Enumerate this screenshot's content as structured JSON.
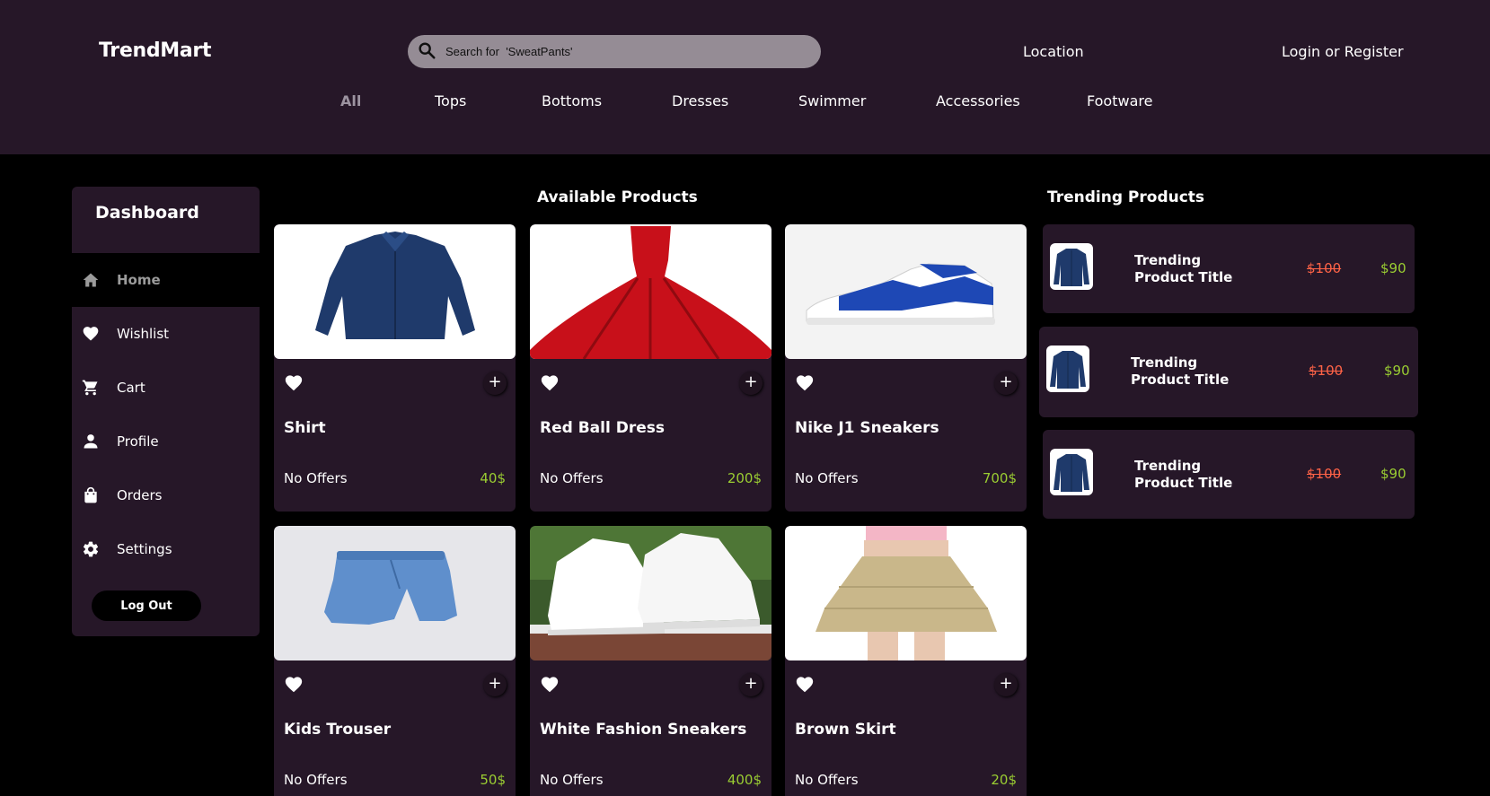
{
  "header": {
    "brand": "TrendMart",
    "search_placeholder": "Search for  'SweatPants'",
    "location_label": "Location",
    "login_label": "Login or Register"
  },
  "nav": {
    "items": [
      "All",
      "Tops",
      "Bottoms",
      "Dresses",
      "Swimmer",
      "Accessories",
      "Footware"
    ],
    "active": "All"
  },
  "sidebar": {
    "title": "Dashboard",
    "items": [
      {
        "label": "Home",
        "icon": "home-icon",
        "active": true
      },
      {
        "label": "Wishlist",
        "icon": "heart-icon",
        "active": false
      },
      {
        "label": "Cart",
        "icon": "cart-icon",
        "active": false
      },
      {
        "label": "Profile",
        "icon": "person-icon",
        "active": false
      },
      {
        "label": "Orders",
        "icon": "shopping-bag-icon",
        "active": false
      },
      {
        "label": "Settings",
        "icon": "gear-icon",
        "active": false
      }
    ],
    "logout_label": "Log Out"
  },
  "products": {
    "title": "Available Products",
    "add_label": "+",
    "items": [
      {
        "name": "Shirt",
        "offer": "No Offers",
        "price": "40$",
        "image": "navy-shirt"
      },
      {
        "name": "Red Ball Dress",
        "offer": "No Offers",
        "price": "200$",
        "image": "red-ball-dress"
      },
      {
        "name": "Nike J1 Sneakers",
        "offer": "No Offers",
        "price": "700$",
        "image": "blue-white-sneaker"
      },
      {
        "name": "Kids Trouser",
        "offer": "No Offers",
        "price": "50$",
        "image": "denim-trouser"
      },
      {
        "name": "White Fashion Sneakers",
        "offer": "No Offers",
        "price": "400$",
        "image": "white-sneakers"
      },
      {
        "name": "Brown Skirt",
        "offer": "No Offers",
        "price": "20$",
        "image": "beige-skirt"
      }
    ]
  },
  "trending": {
    "title": "Trending Products",
    "items": [
      {
        "title": "Trending Product Title",
        "old_price": "$100",
        "new_price": "$90"
      },
      {
        "title": "Trending Product Title",
        "old_price": "$100",
        "new_price": "$90"
      },
      {
        "title": "Trending Product Title",
        "old_price": "$100",
        "new_price": "$90"
      }
    ]
  },
  "colors": {
    "header_bg": "#261728",
    "page_bg": "#000000",
    "price_green": "#9acd32",
    "old_price_red": "#ff6347"
  }
}
